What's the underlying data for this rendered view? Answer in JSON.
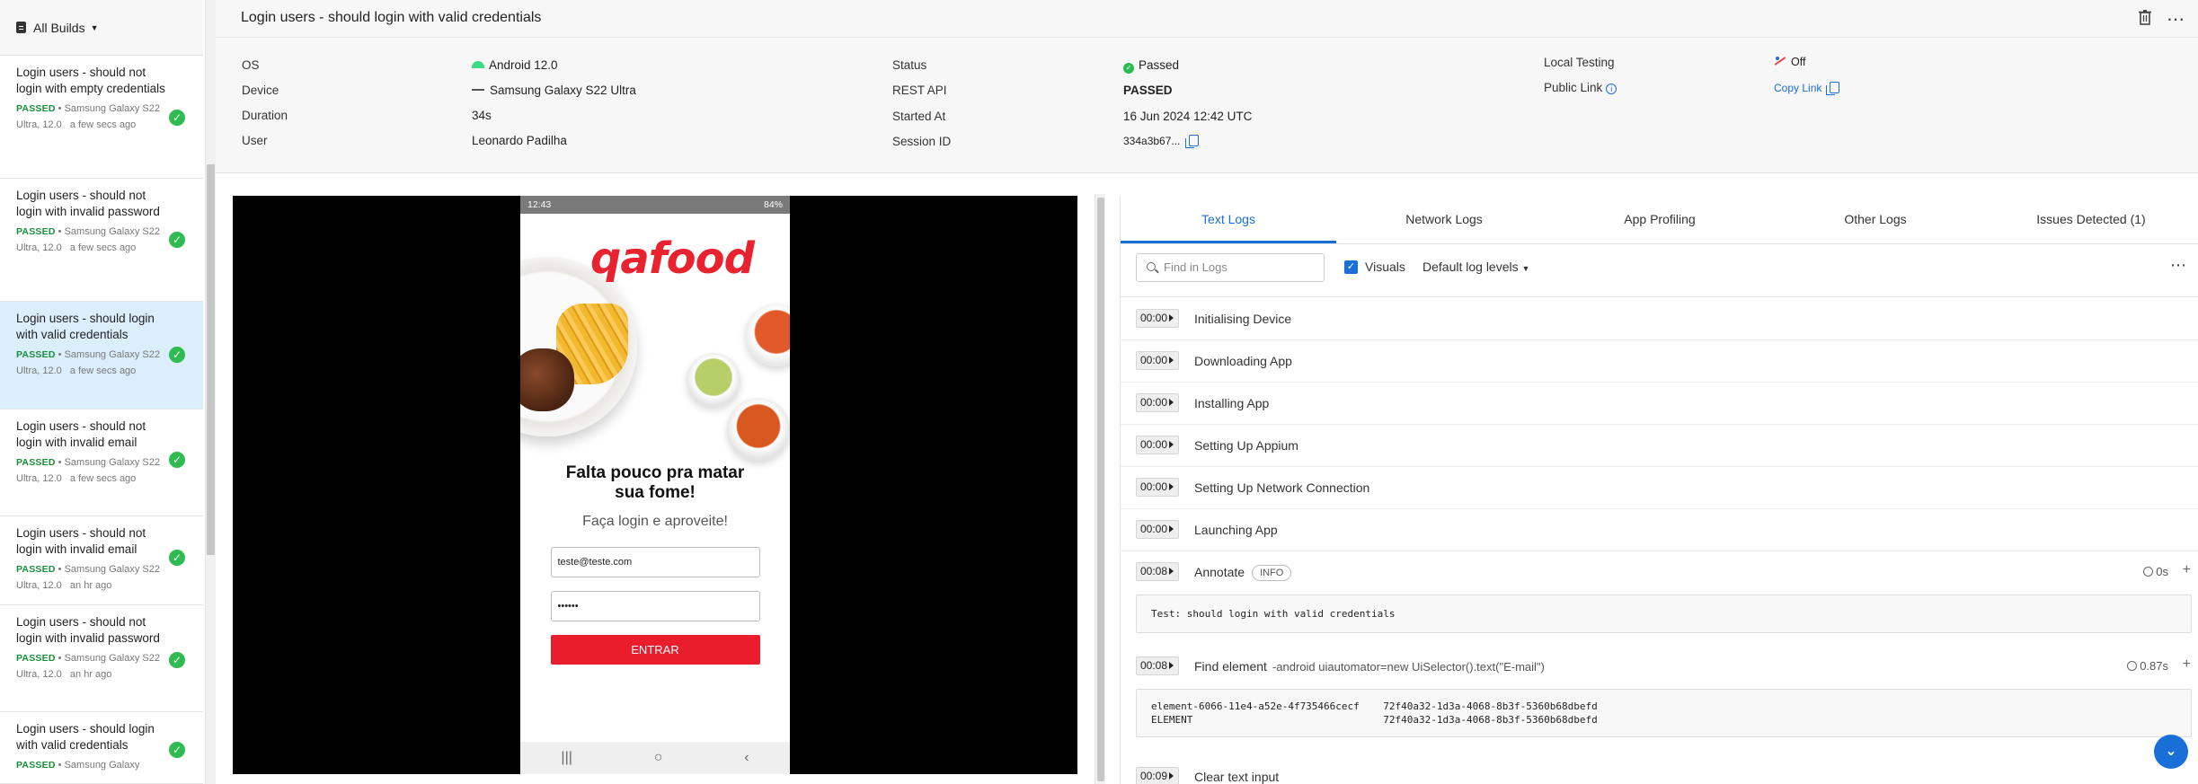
{
  "sidebar": {
    "filter_label": "All Builds",
    "items": [
      {
        "title": "Login users - should not login with empty credentials",
        "status": "PASSED",
        "device": "Samsung Galaxy S22 Ultra, 12.0",
        "time": "a few secs ago"
      },
      {
        "title": "Login users - should not login with invalid password",
        "status": "PASSED",
        "device": "Samsung Galaxy S22 Ultra, 12.0",
        "time": "a few secs ago"
      },
      {
        "title": "Login users - should login with valid credentials",
        "status": "PASSED",
        "device": "Samsung Galaxy S22 Ultra, 12.0",
        "time": "a few secs ago"
      },
      {
        "title": "Login users - should not login with invalid email",
        "status": "PASSED",
        "device": "Samsung Galaxy S22 Ultra, 12.0",
        "time": "a few secs ago"
      },
      {
        "title": "Login users - should not login with invalid email",
        "status": "PASSED",
        "device": "Samsung Galaxy S22 Ultra, 12.0",
        "time": "an hr ago"
      },
      {
        "title": "Login users - should not login with invalid password",
        "status": "PASSED",
        "device": "Samsung Galaxy S22 Ultra, 12.0",
        "time": "an hr ago"
      },
      {
        "title": "Login users - should login with valid credentials",
        "status": "PASSED",
        "device": "Samsung Galaxy",
        "time": ""
      }
    ]
  },
  "header": {
    "title": "Login users - should login with valid credentials"
  },
  "info": {
    "os_label": "OS",
    "os_value": "Android 12.0",
    "device_label": "Device",
    "device_value": "Samsung Galaxy S22 Ultra",
    "duration_label": "Duration",
    "duration_value": "34s",
    "user_label": "User",
    "user_value": "Leonardo Padilha",
    "status_label": "Status",
    "status_value": "Passed",
    "rest_label": "REST API",
    "rest_value": "PASSED",
    "started_label": "Started At",
    "started_value": "16 Jun 2024 12:42 UTC",
    "session_label": "Session ID",
    "session_value": "334a3b67...",
    "local_label": "Local Testing",
    "local_value": "Off",
    "public_label": "Public Link",
    "public_value": "Copy Link"
  },
  "phone": {
    "status_time": "12:43",
    "status_right": "84%",
    "logo": "qafood",
    "headline": "Falta pouco pra matar sua fome!",
    "subtitle": "Faça login e aproveite!",
    "email_value": "teste@teste.com",
    "password_value": "••••••",
    "button_label": "ENTRAR"
  },
  "logs": {
    "tabs": [
      "Text Logs",
      "Network Logs",
      "App Profiling",
      "Other Logs",
      "Issues Detected (1)"
    ],
    "search_placeholder": "Find in Logs",
    "visuals_label": "Visuals",
    "levels_label": "Default log levels",
    "rows": [
      {
        "ts": "00:00",
        "text": "Initialising Device"
      },
      {
        "ts": "00:00",
        "text": "Downloading App"
      },
      {
        "ts": "00:00",
        "text": "Installing App"
      },
      {
        "ts": "00:00",
        "text": "Setting Up Appium"
      },
      {
        "ts": "00:00",
        "text": "Setting Up Network Connection"
      },
      {
        "ts": "00:00",
        "text": "Launching App"
      }
    ],
    "annotate": {
      "ts": "00:08",
      "text": "Annotate",
      "badge": "INFO",
      "duration": "0s",
      "code": "Test: should login with valid credentials"
    },
    "find": {
      "ts": "00:08",
      "text": "Find element",
      "sub": "-android uiautomator=new UiSelector().text(\"E-mail\")",
      "duration": "0.87s",
      "code_line1": "element-6066-11e4-a52e-4f735466cecf    72f40a32-1d3a-4068-8b3f-5360b68dbefd",
      "code_line2": "ELEMENT                                72f40a32-1d3a-4068-8b3f-5360b68dbefd"
    },
    "clear": {
      "ts": "00:09",
      "text": "Clear text input"
    }
  }
}
